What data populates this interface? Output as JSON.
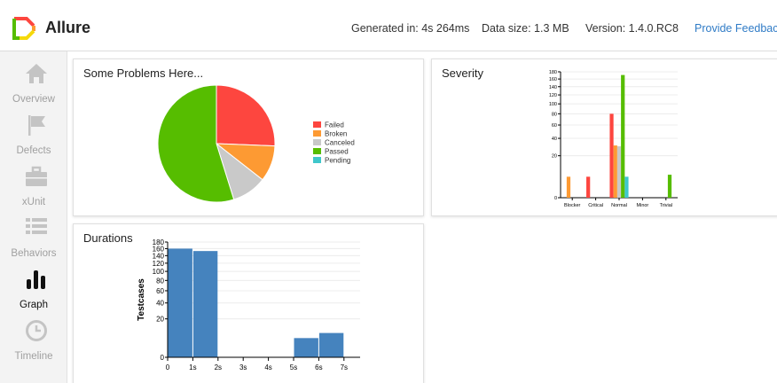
{
  "header": {
    "app_title": "Allure",
    "generated": "Generated in: 4s 264ms",
    "data_size": "Data size: 1.3 MB",
    "version": "Version: 1.4.0.RC8",
    "feedback": "Provide Feedback"
  },
  "sidebar": {
    "items": [
      {
        "label": "Overview",
        "icon": "home-icon",
        "active": false
      },
      {
        "label": "Defects",
        "icon": "flag-icon",
        "active": false
      },
      {
        "label": "xUnit",
        "icon": "briefcase-icon",
        "active": false
      },
      {
        "label": "Behaviors",
        "icon": "list-icon",
        "active": false
      },
      {
        "label": "Graph",
        "icon": "bar-chart-icon",
        "active": true
      },
      {
        "label": "Timeline",
        "icon": "clock-icon",
        "active": false
      }
    ]
  },
  "colors": {
    "failed": "#fd463f",
    "broken": "#fd9a33",
    "canceled": "#c9c9c9",
    "passed": "#56bd00",
    "pending": "#3fc7cb",
    "bar": "#4583be",
    "link": "#2f7bc6"
  },
  "panels": {
    "status": "Some Problems Here...",
    "severity": "Severity",
    "durations": "Durations"
  },
  "chart_data": [
    {
      "type": "pie",
      "title": "Some Problems Here...",
      "categories": [
        "Failed",
        "Broken",
        "Canceled",
        "Passed",
        "Pending"
      ],
      "values": [
        80,
        31,
        30,
        171,
        0
      ],
      "legend": "right"
    },
    {
      "type": "bar",
      "title": "Severity",
      "categories": [
        "Blocker",
        "Critical",
        "Normal",
        "Minor",
        "Trivial"
      ],
      "series": [
        {
          "name": "Failed",
          "values": [
            0,
            5,
            80,
            0,
            0
          ]
        },
        {
          "name": "Broken",
          "values": [
            5,
            0,
            31,
            0,
            0
          ]
        },
        {
          "name": "Canceled",
          "values": [
            0,
            0,
            30,
            0,
            0
          ]
        },
        {
          "name": "Passed",
          "values": [
            0,
            0,
            171,
            0,
            6
          ]
        },
        {
          "name": "Pending",
          "values": [
            0,
            0,
            5,
            0,
            0
          ]
        }
      ],
      "yscale": "sqrt",
      "yticks": [
        0,
        20,
        40,
        60,
        80,
        100,
        120,
        140,
        160,
        180
      ],
      "ylim": [
        0,
        180
      ]
    },
    {
      "type": "bar",
      "title": "Durations",
      "ylabel": "Testcases",
      "xticks": [
        "0",
        "1s",
        "2s",
        "3s",
        "4s",
        "5s",
        "6s",
        "7s"
      ],
      "bins": [
        {
          "start": 0,
          "end": 1,
          "value": 160
        },
        {
          "start": 1,
          "end": 2,
          "value": 153
        },
        {
          "start": 5,
          "end": 6,
          "value": 5
        },
        {
          "start": 6,
          "end": 7,
          "value": 8
        }
      ],
      "yscale": "sqrt",
      "yticks": [
        0,
        20,
        40,
        60,
        80,
        100,
        120,
        140,
        160,
        180
      ],
      "ylim": [
        0,
        180
      ]
    }
  ]
}
